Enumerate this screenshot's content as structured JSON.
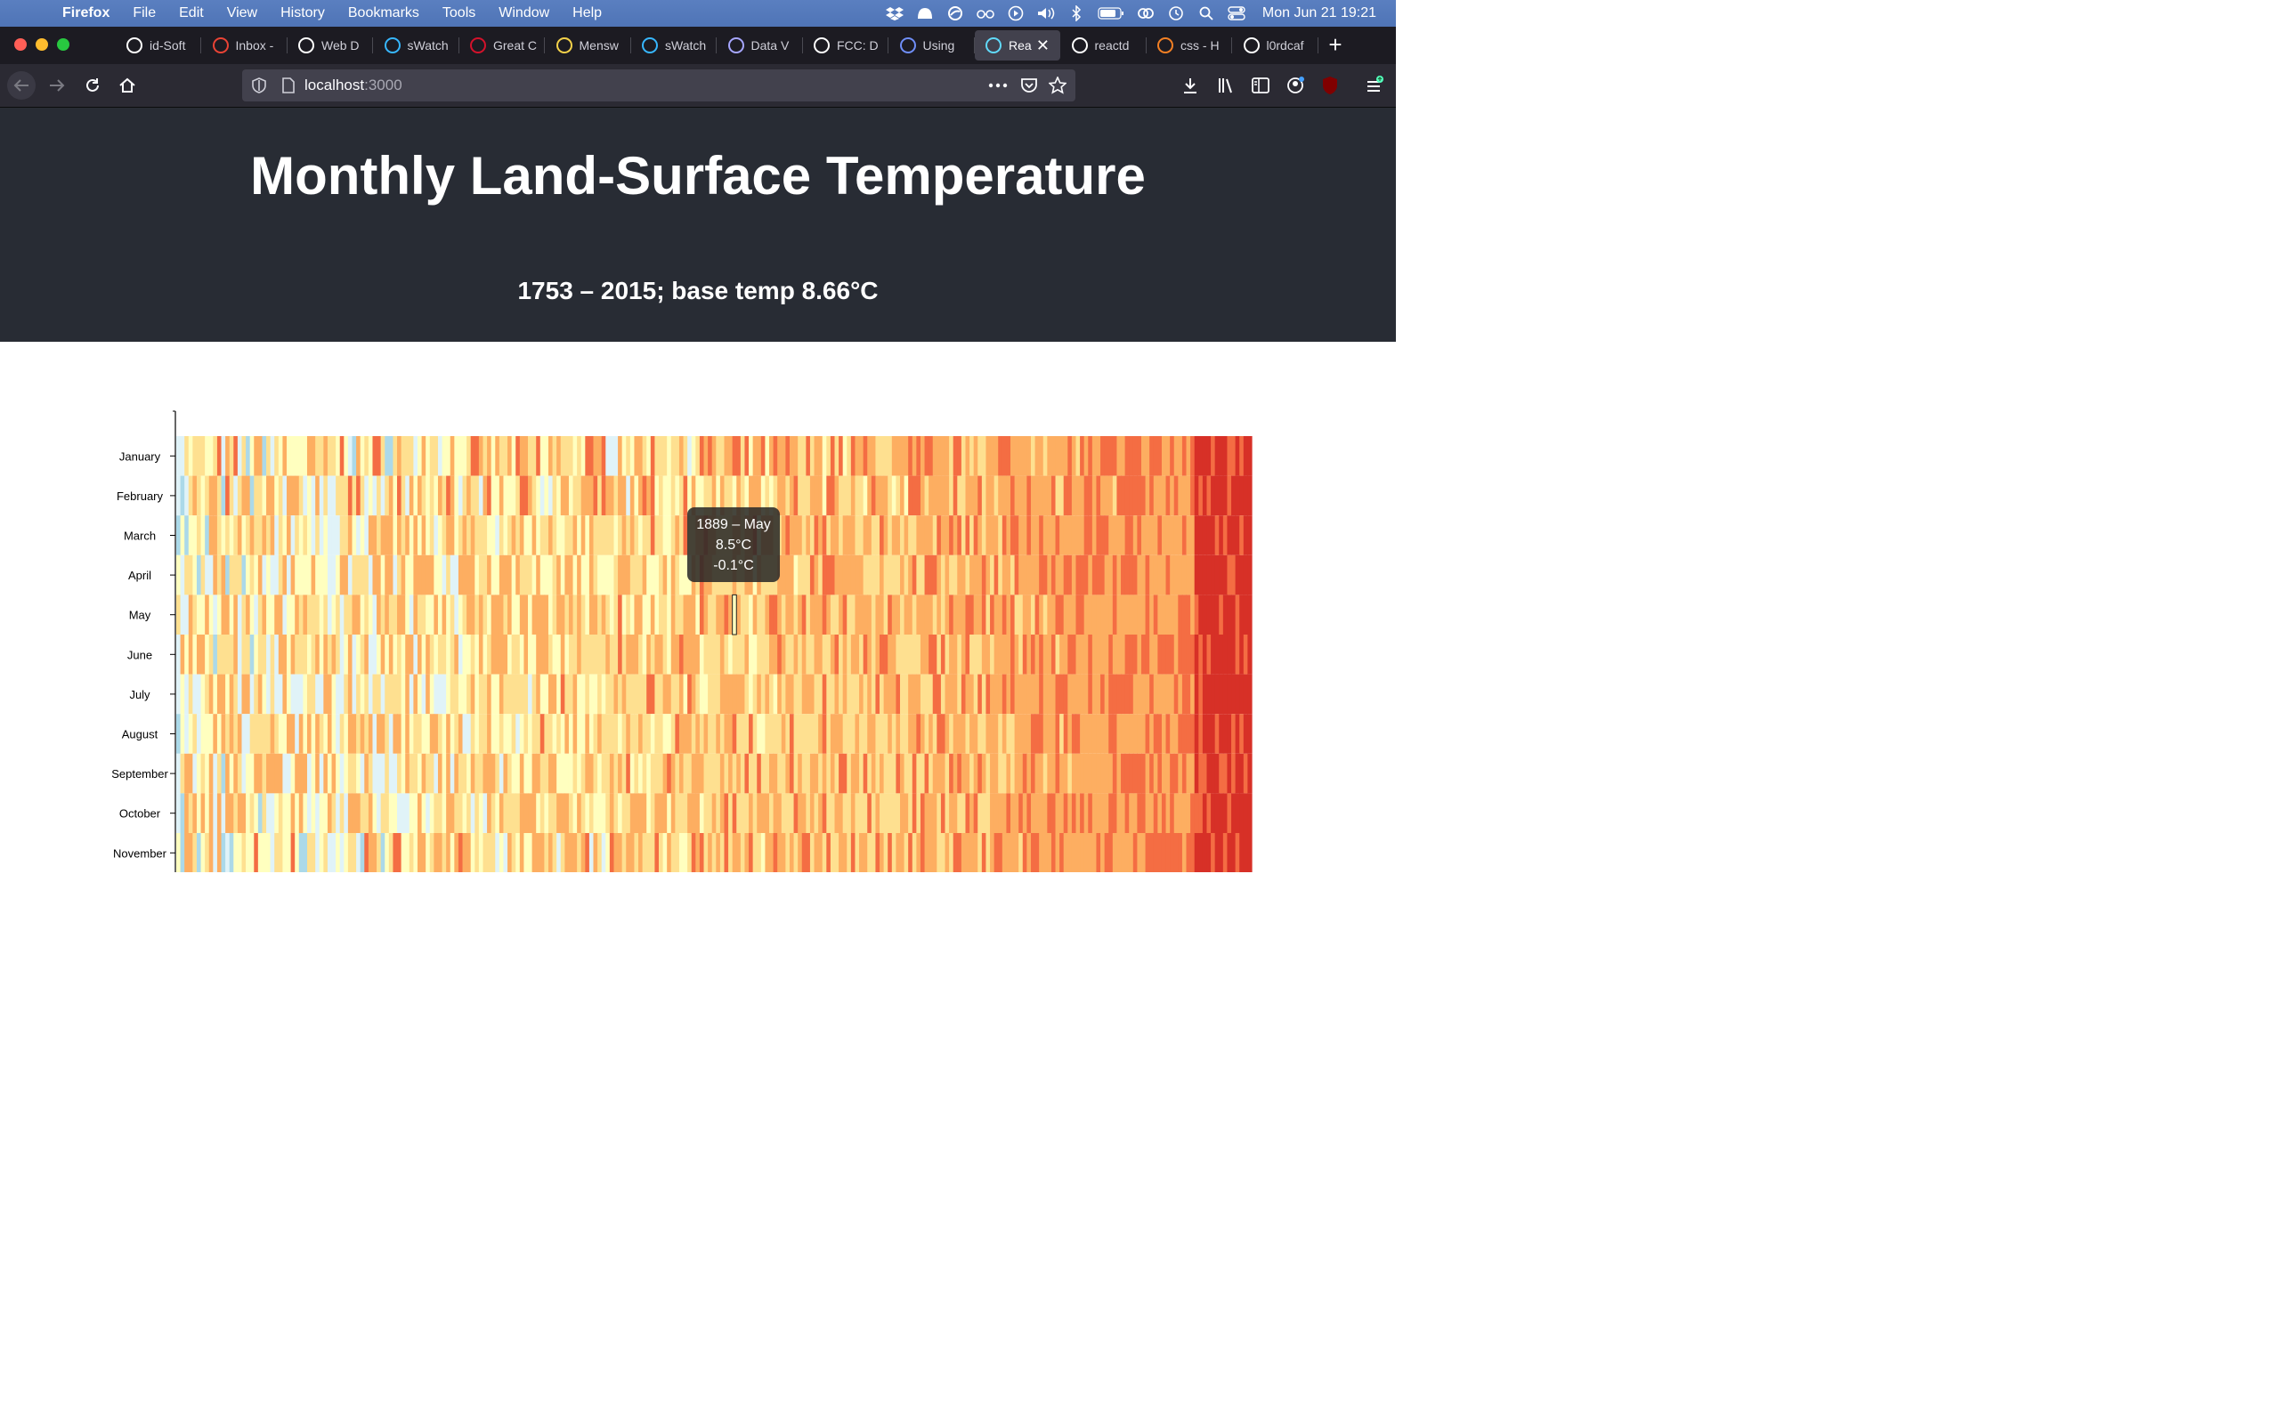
{
  "menubar": {
    "app_name": "Firefox",
    "items": [
      "File",
      "Edit",
      "View",
      "History",
      "Bookmarks",
      "Tools",
      "Window",
      "Help"
    ],
    "clock": "Mon Jun 21  19:21"
  },
  "tabs": [
    {
      "label": "id-Soft",
      "icon": "github-icon",
      "color": "#ffffff"
    },
    {
      "label": "Inbox -",
      "icon": "gmail-icon",
      "color": "#ea4335"
    },
    {
      "label": "Web D",
      "icon": "github-icon",
      "color": "#ffffff"
    },
    {
      "label": "sWatch",
      "icon": "swatch-icon",
      "color": "#37b7ff"
    },
    {
      "label": "Great C",
      "icon": "food-icon",
      "color": "#d3122b"
    },
    {
      "label": "Mensw",
      "icon": "flower-icon",
      "color": "#f5d24a"
    },
    {
      "label": "sWatch",
      "icon": "swatch-icon",
      "color": "#37b7ff"
    },
    {
      "label": "Data V",
      "icon": "freecodecamp-icon",
      "color": "#a6a6ff"
    },
    {
      "label": "FCC: D",
      "icon": "codepen-icon",
      "color": "#ffffff"
    },
    {
      "label": "Using",
      "icon": "cube-icon",
      "color": "#6f8ef7"
    },
    {
      "label": "Rea",
      "icon": "react-icon",
      "color": "#61dafb"
    },
    {
      "label": "reactd",
      "icon": "github-icon",
      "color": "#ffffff"
    },
    {
      "label": "css - H",
      "icon": "stackoverflow-icon",
      "color": "#f48024"
    },
    {
      "label": "l0rdcaf",
      "icon": "github-icon",
      "color": "#ffffff"
    }
  ],
  "url": {
    "host": "localhost",
    "port": ":3000"
  },
  "page": {
    "title": "Monthly Land-Surface Temperature",
    "subtitle": "1753 – 2015; base temp 8.66°C"
  },
  "tooltip": {
    "line1": "1889 – May",
    "line2": "8.5°C",
    "line3": "-0.1°C"
  },
  "chart_data": {
    "type": "heatmap",
    "title": "Monthly Land-Surface Temperature",
    "subtitle": "1753 – 2015; base temp 8.66°C",
    "base_temperature": 8.66,
    "x_range": [
      1753,
      2015
    ],
    "y_categories": [
      "January",
      "February",
      "March",
      "April",
      "May",
      "June",
      "July",
      "August",
      "September",
      "October",
      "November"
    ],
    "color_scale": [
      "#313695",
      "#4575b4",
      "#74add1",
      "#abd9e9",
      "#e0f3f8",
      "#ffffbf",
      "#fee090",
      "#fdae61",
      "#f46d43",
      "#d73027",
      "#a50026"
    ],
    "highlighted_cell": {
      "year": 1889,
      "month": "May",
      "temperature": 8.5,
      "variance": -0.1
    }
  }
}
